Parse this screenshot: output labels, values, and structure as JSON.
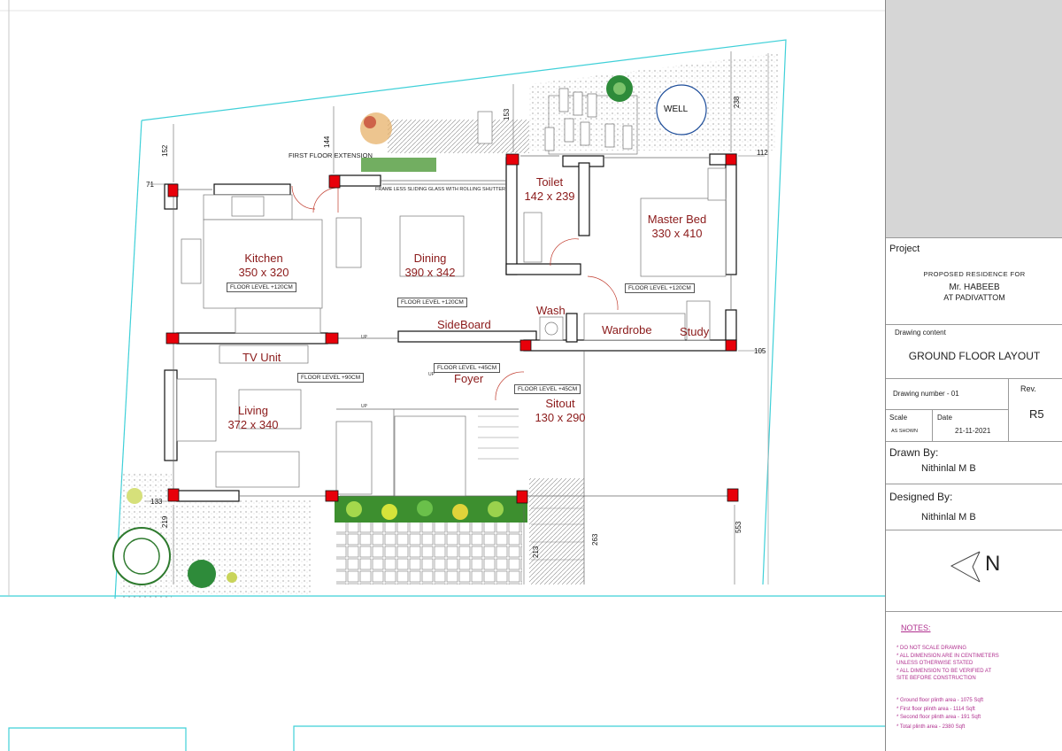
{
  "rooms": {
    "kitchen": {
      "name": "Kitchen",
      "size": "350 x 320"
    },
    "dining": {
      "name": "Dining",
      "size": "390 x 342"
    },
    "toilet": {
      "name": "Toilet",
      "size": "142 x 239"
    },
    "master_bed": {
      "name": "Master Bed",
      "size": "330 x 410"
    },
    "living": {
      "name": "Living",
      "size": "372 x 340"
    },
    "sitout": {
      "name": "Sitout",
      "size": "130 x 290"
    },
    "sideboard": "SideBoard",
    "wash": "Wash",
    "wardrobe": "Wardrobe",
    "study": "Study",
    "tv_unit": "TV Unit",
    "foyer": "Foyer",
    "well": "WELL"
  },
  "levels": {
    "kitchen": "FLOOR LEVEL +120CM",
    "dining": "FLOOR LEVEL +120CM",
    "master_bed": "FLOOR LEVEL +120CM",
    "living": "FLOOR LEVEL +90CM",
    "foyer": "FLOOR LEVEL +45CM",
    "sitout": "FLOOR LEVEL +45CM"
  },
  "notes_plan": {
    "first_floor_ext": "FIRST FLOOR EXTENSION",
    "frameless": "FRAME LESS  SLIDING GLASS WITH ROLLING SHUTTER",
    "up": "UP"
  },
  "dimensions": {
    "d152": "152",
    "d144": "144",
    "d153": "153",
    "d238": "238",
    "d112": "112",
    "d71": "71",
    "d105": "105",
    "d133": "133",
    "d219": "219",
    "d213": "213",
    "d263": "263",
    "d553": "553"
  },
  "title_block": {
    "project_label": "Project",
    "project_line1": "PROPOSED RESIDENCE FOR",
    "client": "Mr. HABEEB",
    "location": "AT PADIVATTOM",
    "drawing_content_label": "Drawing content",
    "drawing_content": "GROUND FLOOR LAYOUT",
    "drawing_number": "Drawing number  - 01",
    "rev_label": "Rev.",
    "rev": "R5",
    "scale_label": "Scale",
    "scale": "AS SHOWN",
    "date_label": "Date",
    "date": "21-11-2021",
    "drawn_by_label": "Drawn By:",
    "drawn_by": "Nithinlal M B",
    "designed_by_label": "Designed By:",
    "designed_by": "Nithinlal M B",
    "north": "N",
    "notes_title": "NOTES:",
    "notes": [
      "* DO NOT SCALE DRAWING",
      "* ALL DIMENSION ARE IN CENTIMETERS",
      "  UNLESS OTHERWISE STATED",
      "* ALL DIMENSION TO BE VERIFIED AT",
      "  SITE BEFORE CONSTRUCTION"
    ],
    "areas": [
      "* Ground floor plinth area  -   1075 Sqft",
      "* First floor plinth area    -   1114 Sqft",
      "* Second floor plinth area  -   191 Sqft",
      "* Total plinth area           -   2380 Sqft"
    ]
  },
  "colors": {
    "plot": "#3fd0d8",
    "column": "#e8000a",
    "label": "#8b1a1a",
    "notes": "#b0308f"
  }
}
